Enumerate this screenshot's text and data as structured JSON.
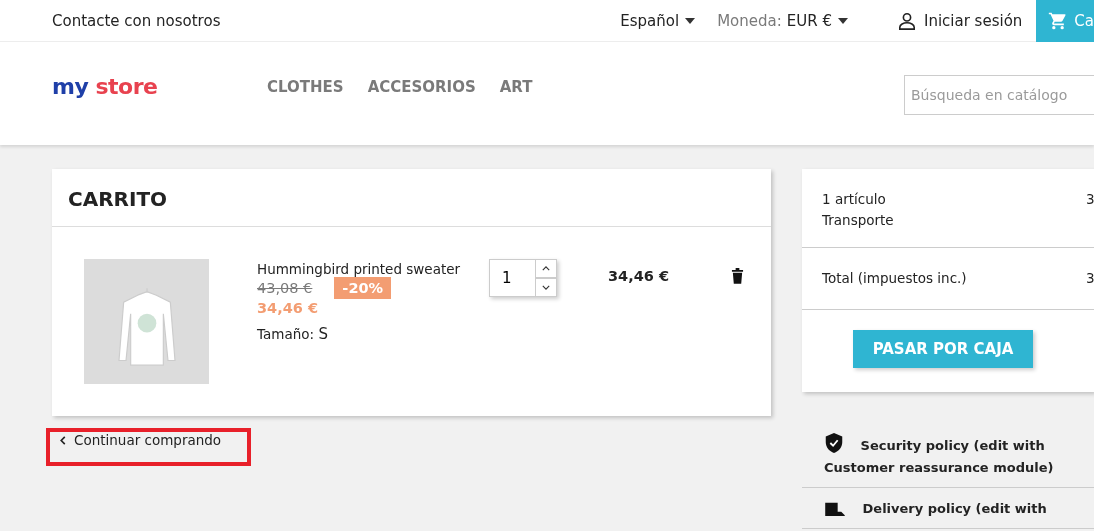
{
  "top_bar": {
    "contact": "Contacte con nosotros",
    "language": "Español",
    "currency_label": "Moneda:",
    "currency": "EUR €",
    "sign_in": "Iniciar sesión",
    "cart": "Ca"
  },
  "header": {
    "logo": {
      "my": "my",
      "store": "store"
    },
    "menu": [
      {
        "label": "CLOTHES"
      },
      {
        "label": "ACCESORIOS"
      },
      {
        "label": "ART"
      }
    ],
    "search": {
      "placeholder": "Búsqueda en catálogo"
    }
  },
  "cart": {
    "title": "CARRITO",
    "items": [
      {
        "name": "Hummingbird printed sweater",
        "regular_price": "43,08 €",
        "discount": "-20%",
        "price": "34,46 €",
        "attribute_label": "Tamaño:",
        "attribute_value": "S",
        "quantity": "1",
        "total": "34,46 €"
      }
    ]
  },
  "continue_link": {
    "label": "Continuar comprando",
    "highlighted": true
  },
  "summary": {
    "lines": [
      {
        "label": "1 artículo",
        "value": "3"
      },
      {
        "label": "Transporte"
      }
    ],
    "total": {
      "label": "Total (impuestos inc.)",
      "value": "3"
    },
    "checkout": "PASAR POR CAJA"
  },
  "reassurance": [
    {
      "kind": "security",
      "text": "Security policy (edit with Customer reassurance module)"
    },
    {
      "kind": "delivery",
      "text": "Delivery policy (edit with"
    }
  ]
}
